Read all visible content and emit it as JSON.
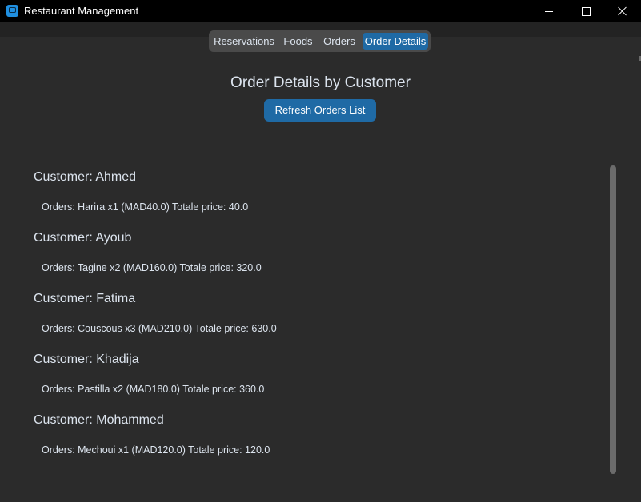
{
  "window": {
    "title": "Restaurant Management"
  },
  "tabs": [
    {
      "label": "Reservations",
      "selected": false
    },
    {
      "label": "Foods",
      "selected": false
    },
    {
      "label": "Orders",
      "selected": false
    },
    {
      "label": "Order Details",
      "selected": true
    }
  ],
  "main": {
    "title": "Order Details by Customer",
    "refresh_label": "Refresh Orders List"
  },
  "customers": [
    {
      "name": "Customer: Ahmed",
      "orders": "Orders: Harira x1 (MAD40.0) Totale price: 40.0"
    },
    {
      "name": "Customer: Ayoub",
      "orders": "Orders: Tagine x2 (MAD160.0) Totale price: 320.0"
    },
    {
      "name": "Customer: Fatima",
      "orders": "Orders: Couscous x3 (MAD210.0) Totale price: 630.0"
    },
    {
      "name": "Customer: Khadija",
      "orders": "Orders: Pastilla x2 (MAD180.0) Totale price: 360.0"
    },
    {
      "name": "Customer: Mohammed",
      "orders": "Orders: Mechoui x1 (MAD120.0) Totale price: 120.0"
    }
  ],
  "colors": {
    "accent": "#1f6aa5",
    "background": "#2b2b2b",
    "titlebar": "#000000",
    "text": "#dce4ee"
  },
  "icons": {
    "app": "app-icon",
    "minimize": "minimize-icon",
    "maximize": "maximize-icon",
    "close": "close-icon"
  }
}
